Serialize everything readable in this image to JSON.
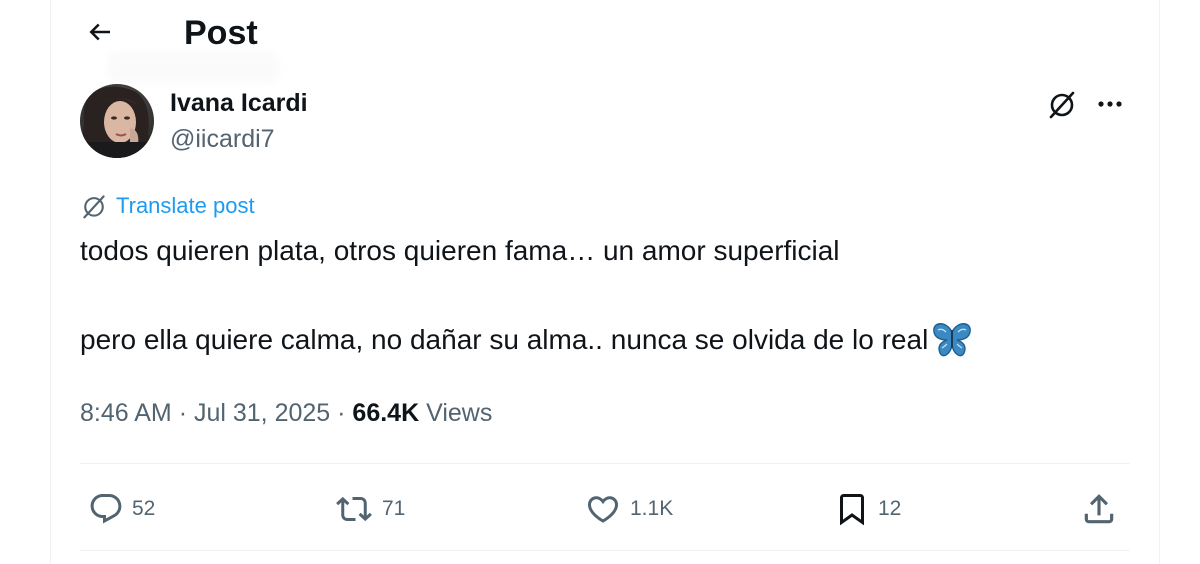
{
  "header": {
    "title": "Post"
  },
  "author": {
    "display_name": "Ivana Icardi",
    "handle": "@iicardi7"
  },
  "translate": {
    "label": "Translate post"
  },
  "tweet": {
    "line1": "todos quieren plata, otros quieren fama… un amor superficial",
    "line2": "pero ella quiere calma, no dañar su alma.. nunca se olvida de lo real",
    "emoji": "butterfly"
  },
  "meta": {
    "time": "8:46 AM",
    "separator": "·",
    "date": "Jul 31, 2025",
    "views_count": "66.4K",
    "views_label": "Views"
  },
  "actions": {
    "replies": "52",
    "reposts": "71",
    "likes": "1.1K",
    "bookmarks": "12"
  },
  "colors": {
    "text_primary": "#0f1419",
    "text_secondary": "#536471",
    "link": "#1d9bf0",
    "divider": "#eff3f4",
    "emoji_blue": "#3b88c3"
  },
  "icons": {
    "back": "arrow-left-icon",
    "grok": "grok-icon",
    "more": "more-horizontal-icon",
    "reply": "reply-bubble-icon",
    "repost": "repost-icon",
    "like": "heart-icon",
    "bookmark": "bookmark-icon",
    "share": "share-icon"
  }
}
